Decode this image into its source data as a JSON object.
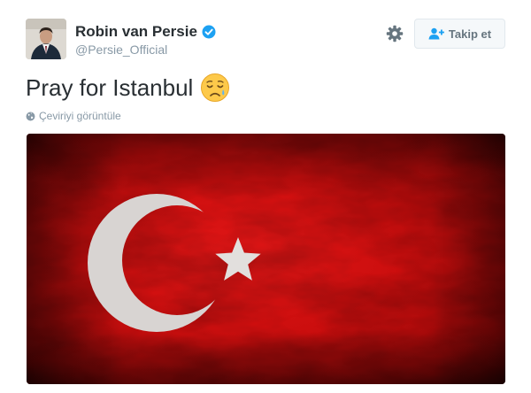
{
  "user": {
    "display_name": "Robin van Persie",
    "handle": "@Persie_Official",
    "verified": true
  },
  "header": {
    "follow_label": "Takip et"
  },
  "tweet": {
    "text": "Pray for Istanbul",
    "emoji": "sad-relieved-face",
    "translate_label": "Çeviriyi görüntüle"
  },
  "media": {
    "type": "image",
    "subject": "turkish-flag",
    "colors": {
      "flag_red": "#c40d0d",
      "crescent": "#d6d3d0"
    }
  },
  "colors": {
    "verified_blue": "#1da1f2",
    "muted_text": "#8899a6",
    "main_text": "#292f33"
  }
}
